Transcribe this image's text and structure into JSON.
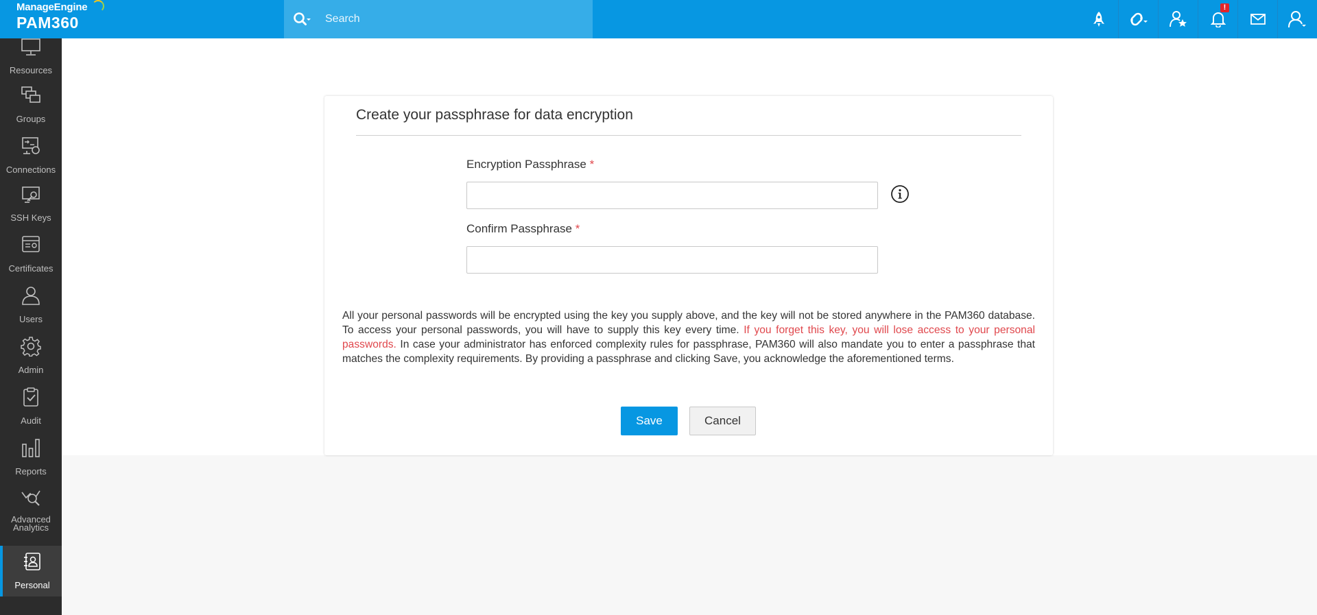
{
  "header": {
    "brand": "ManageEngine",
    "product": "PAM360",
    "search_placeholder": "Search",
    "notification_badge": "!",
    "icons": [
      "rocket-icon",
      "link-icon",
      "user-star-icon",
      "bell-icon",
      "mail-icon",
      "user-menu-icon"
    ]
  },
  "sidebar": {
    "items": [
      {
        "label": "Resources",
        "icon": "monitor-icon"
      },
      {
        "label": "Groups",
        "icon": "groups-icon"
      },
      {
        "label": "Connections",
        "icon": "connections-icon"
      },
      {
        "label": "SSH Keys",
        "icon": "ssh-key-icon"
      },
      {
        "label": "Certificates",
        "icon": "certificate-icon"
      },
      {
        "label": "Users",
        "icon": "user-icon"
      },
      {
        "label": "Admin",
        "icon": "gear-icon"
      },
      {
        "label": "Audit",
        "icon": "clipboard-check-icon"
      },
      {
        "label": "Reports",
        "icon": "bar-chart-icon"
      },
      {
        "label": "Advanced Analytics",
        "icon": "analytics-icon"
      },
      {
        "label": "Personal",
        "icon": "personal-contact-icon",
        "active": true
      }
    ]
  },
  "form": {
    "title": "Create your passphrase for data encryption",
    "encryption_label": "Encryption Passphrase",
    "confirm_label": "Confirm Passphrase",
    "required_marker": "*",
    "encryption_value": "",
    "confirm_value": "",
    "notice_part1": "All your personal passwords will be encrypted using the key you supply above, and the key will not be stored anywhere in the PAM360 database. To access your personal passwords, you will have to supply this key every time. ",
    "notice_warning": "If you forget this key, you will lose access to your personal passwords.",
    "notice_part2": " In case your administrator has enforced complexity rules for passphrase, PAM360 will also mandate you to enter a passphrase that matches the complexity requirements. By providing a passphrase and clicking Save, you acknowledge the aforementioned terms.",
    "save_label": "Save",
    "cancel_label": "Cancel"
  },
  "colors": {
    "brand_blue": "#0797e2",
    "sidebar_bg": "#2c2c2c",
    "warning_red": "#e0474c"
  }
}
